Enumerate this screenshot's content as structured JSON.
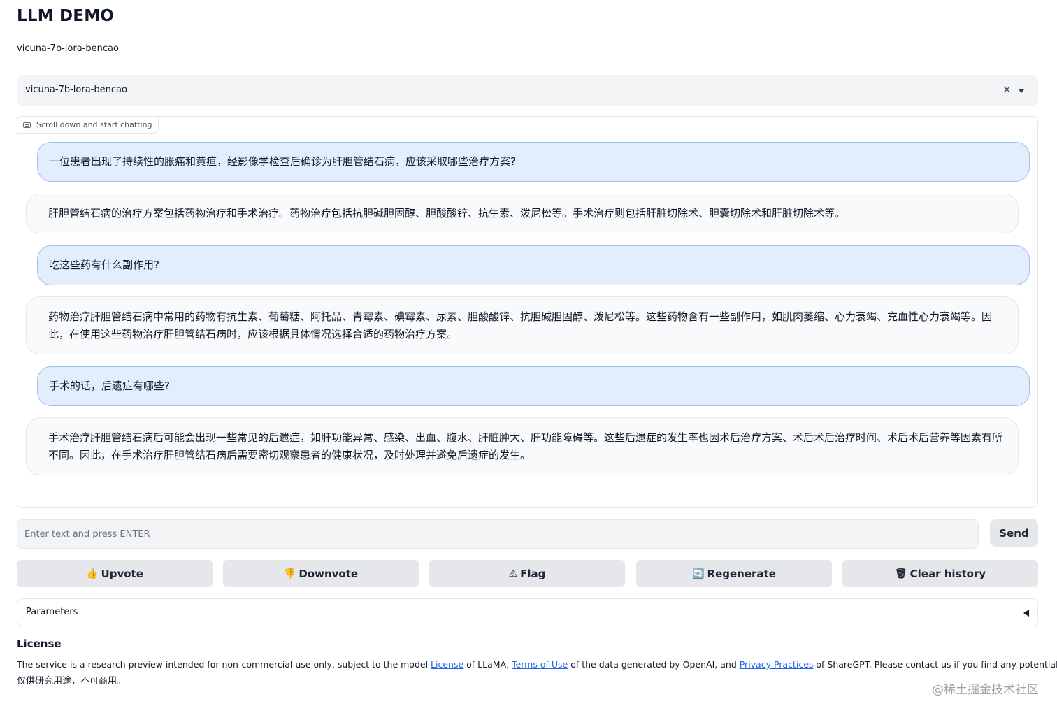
{
  "header": {
    "title": "LLM DEMO",
    "model_label": "vicuna-7b-lora-bencao"
  },
  "model_select": {
    "value": "vicuna-7b-lora-bencao",
    "clear_icon": "×"
  },
  "chatbot": {
    "label": "Scroll down and start chatting",
    "messages": [
      {
        "role": "user",
        "text": "一位患者出现了持续性的胀痛和黄疸，经影像学检查后确诊为肝胆管结石病，应该采取哪些治疗方案?"
      },
      {
        "role": "bot",
        "text": "肝胆管结石病的治疗方案包括药物治疗和手术治疗。药物治疗包括抗胆碱胆固醇、胆酸酸锌、抗生素、泼尼松等。手术治疗则包括肝脏切除术、胆囊切除术和肝脏切除术等。"
      },
      {
        "role": "user",
        "text": "吃这些药有什么副作用?"
      },
      {
        "role": "bot",
        "text": "药物治疗肝胆管结石病中常用的药物有抗生素、葡萄糖、阿托品、青霉素、碘霉素、尿素、胆酸酸锌、抗胆碱胆固醇、泼尼松等。这些药物含有一些副作用，如肌肉萎缩、心力衰竭、充血性心力衰竭等。因此，在使用这些药物治疗肝胆管结石病时，应该根据具体情况选择合适的药物治疗方案。"
      },
      {
        "role": "user",
        "text": "手术的话，后遗症有哪些?"
      },
      {
        "role": "bot",
        "text": "手术治疗肝胆管结石病后可能会出现一些常见的后遗症，如肝功能异常、感染、出血、腹水、肝脏肿大、肝功能障碍等。这些后遗症的发生率也因术后治疗方案、术后术后治疗时间、术后术后营养等因素有所不同。因此，在手术治疗肝胆管结石病后需要密切观察患者的健康状况，及时处理并避免后遗症的发生。"
      }
    ]
  },
  "input": {
    "placeholder": "Enter text and press ENTER",
    "value": ""
  },
  "send_button": "Send",
  "actions": [
    {
      "label": "Upvote",
      "icon": "👍",
      "icon_name": "thumbs-up-icon"
    },
    {
      "label": "Downvote",
      "icon": "👎",
      "icon_name": "thumbs-down-icon"
    },
    {
      "label": "Flag",
      "icon": "⚠",
      "icon_name": "warning-icon"
    },
    {
      "label": "Regenerate",
      "icon": "🔄",
      "icon_name": "refresh-icon"
    },
    {
      "label": "Clear history",
      "icon": "🗑",
      "icon_name": "trash-icon"
    }
  ],
  "parameters": {
    "label": "Parameters"
  },
  "license": {
    "title": "License",
    "text_1": "The service is a research preview intended for non-commercial use only, subject to the model ",
    "link_1": "License",
    "text_2": " of LLaMA, ",
    "link_2": "Terms of Use",
    "text_3": " of the data generated by OpenAI, and ",
    "link_3": "Privacy Practices",
    "text_4": " of ShareGPT. Please contact us if you find any potential violation.",
    "cn_text": "仅供研究用途，不可商用。"
  },
  "watermark": "@稀土掘金技术社区",
  "colors": {
    "user_bubble": "#e3eefc",
    "user_border": "#9ec0ec",
    "bot_bubble": "#f9fafb",
    "button_bg": "#e5e7eb",
    "link": "#2563eb"
  }
}
